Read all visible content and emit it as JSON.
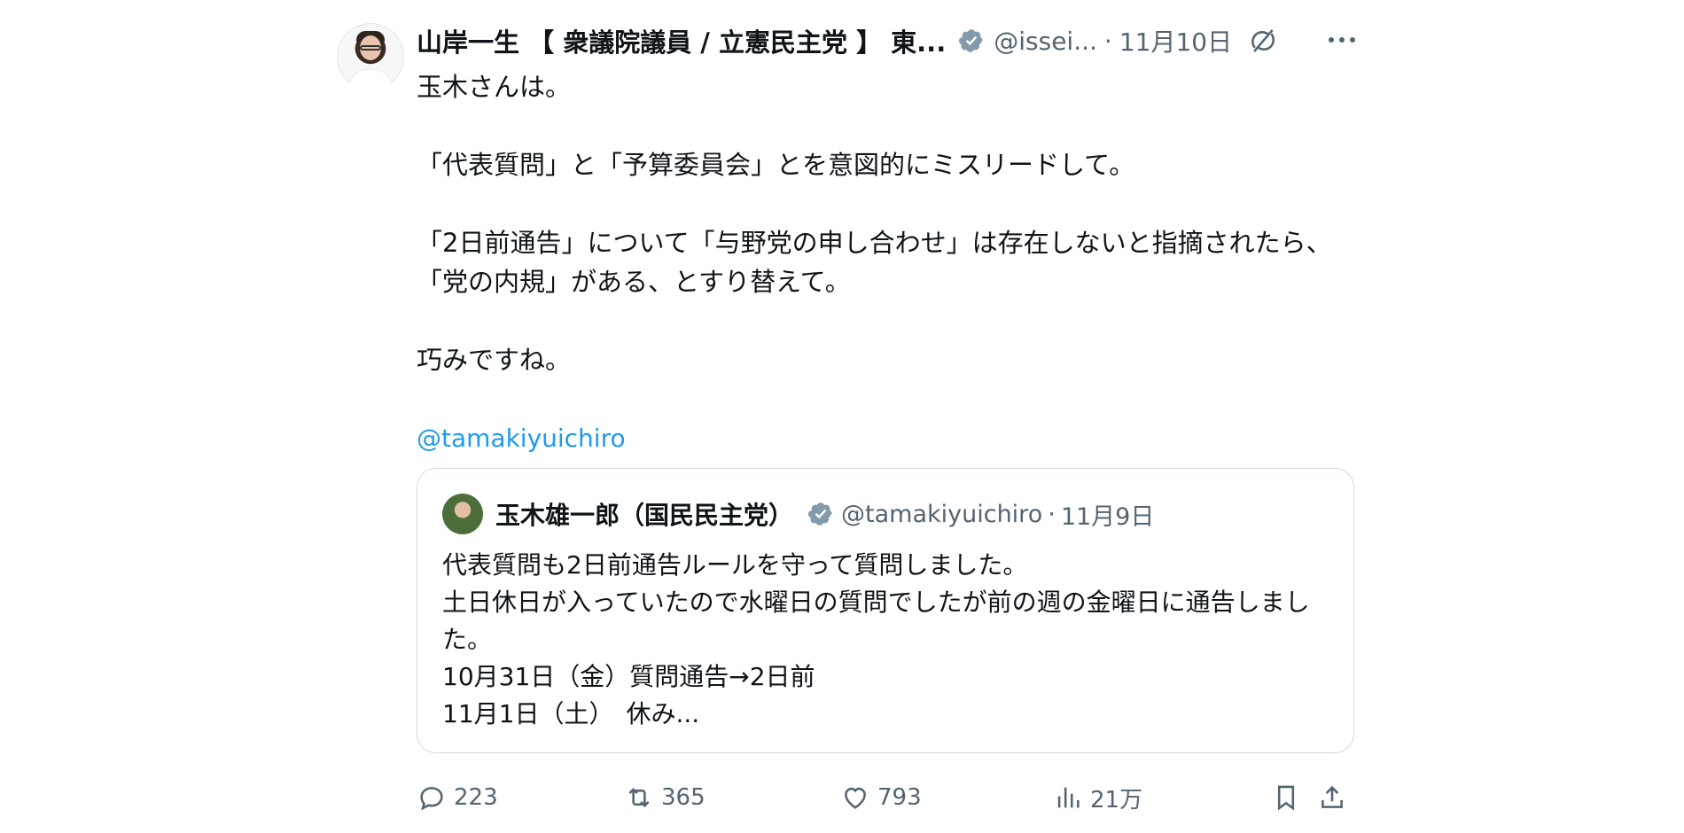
{
  "author": {
    "name": "山岸一生 【 衆議院議員 / 立憲民主党 】 東...",
    "handle": "@issei...",
    "separator": "·",
    "date": "11月10日"
  },
  "post": {
    "lines": [
      "玉木さんは。",
      "",
      "「代表質問」と「予算委員会」とを意図的にミスリードして。",
      "",
      "「2日前通告」について「与野党の申し合わせ」は存在しないと指摘されたら、「党の内規」がある、とすり替えて。",
      "",
      "巧みですね。",
      ""
    ],
    "mention": "@tamakiyuichiro"
  },
  "quoted": {
    "name": "玉木雄一郎（国民民主党）",
    "handle": "@tamakiyuichiro",
    "separator": "·",
    "date": "11月9日",
    "lines": [
      "代表質問も2日前通告ルールを守って質問しました。",
      "土日休日が入っていたので水曜日の質問でしたが前の週の金曜日に通告しました。",
      "10月31日（金）質問通告→2日前",
      "11月1日（土）　休み..."
    ]
  },
  "actions": {
    "replies": "223",
    "reposts": "365",
    "likes": "793",
    "views": "21万"
  },
  "icons": {
    "verified": "verified-badge-icon",
    "grok": "grok-icon",
    "more": "more-icon",
    "reply": "reply-icon",
    "repost": "repost-icon",
    "like": "like-icon",
    "views": "views-icon",
    "bookmark": "bookmark-icon",
    "share": "share-icon"
  },
  "colors": {
    "text": "#0f1419",
    "secondary": "#536471",
    "link": "#1d9bf0",
    "border": "#cfd9de",
    "verified": "#829aab"
  }
}
